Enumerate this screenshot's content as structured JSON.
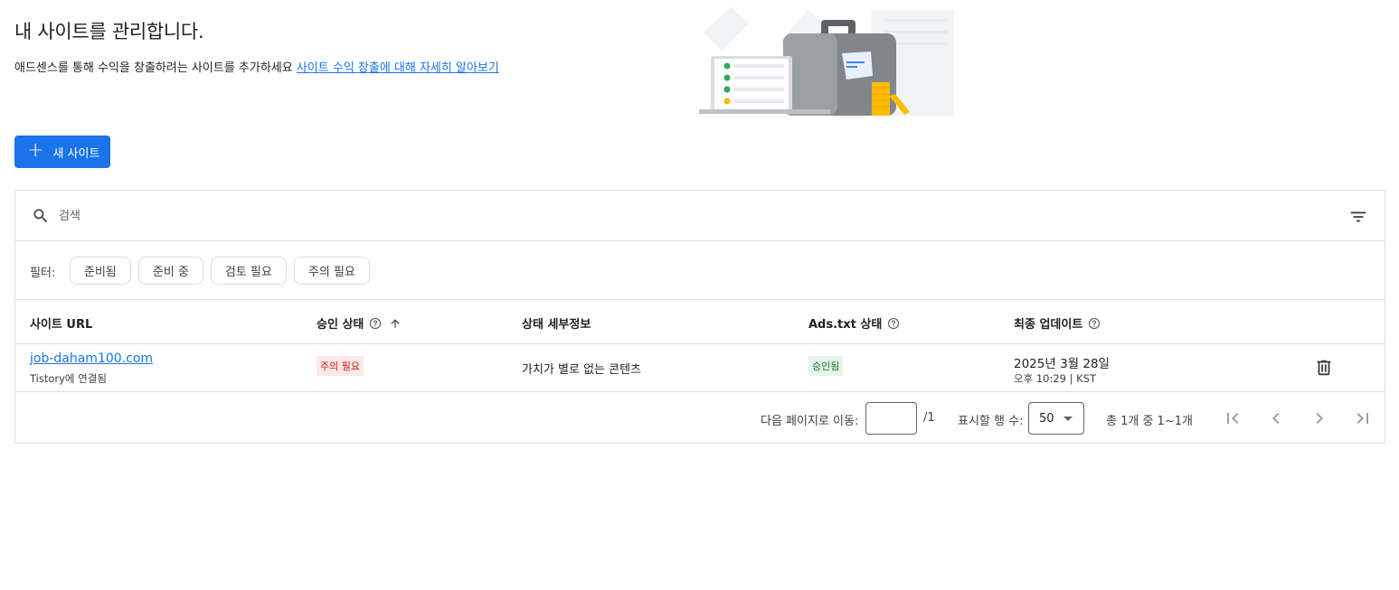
{
  "header": {
    "title": "내 사이트를 관리합니다.",
    "subtitle": "애드센스를 통해 수익을 창출하려는 사이트를 추가하세요 ",
    "learn_more_link": "사이트 수익 창출에 대해 자세히 알아보기"
  },
  "toolbar": {
    "new_site_label": "새 사이트"
  },
  "search": {
    "placeholder": "검색"
  },
  "filters": {
    "label": "필터:",
    "chips": [
      "준비됨",
      "준비 중",
      "검토 필요",
      "주의 필요"
    ]
  },
  "table": {
    "columns": {
      "site_url": "사이트 URL",
      "approval_status": "승인 상태",
      "status_details": "상태 세부정보",
      "ads_txt_status": "Ads.txt 상태",
      "last_updated": "최종 업데이트"
    },
    "rows": [
      {
        "site": "job-daham100.com",
        "site_sub": "Tistory에 연결됨",
        "approval": "주의 필요",
        "details": "가치가 별로 없는 콘텐츠",
        "ads_txt": "승인됨",
        "date": "2025년 3월 28일",
        "time": "오후 10:29 | KST"
      }
    ]
  },
  "pagination": {
    "goto_label": "다음 페이지로 이동:",
    "goto_value": "",
    "total_pages": "/1",
    "rows_label": "표시할 행 수:",
    "rows_value": "50",
    "range": "총 1개 중 1~1개"
  },
  "colors": {
    "primary": "#1a73e8",
    "warn_bg": "#fce8e6",
    "warn_text": "#c5221f",
    "ok_bg": "#e6f4ea",
    "ok_text": "#137333",
    "border": "#dadce0"
  },
  "icons": [
    "plus-icon",
    "search-icon",
    "filter-list-icon",
    "help-icon",
    "sort-arrow-up-icon",
    "trash-icon",
    "first-page-icon",
    "prev-page-icon",
    "next-page-icon",
    "last-page-icon"
  ]
}
